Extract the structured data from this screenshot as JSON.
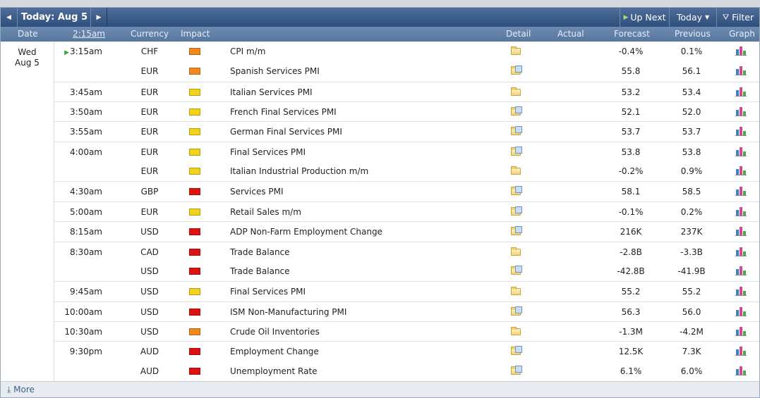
{
  "toolbar": {
    "prev_icon": "◀",
    "today_label": "Today: Aug 5",
    "next_icon": "▶",
    "up_next_label": "Up Next",
    "today_button_label": "Today",
    "filter_label": "Filter"
  },
  "columns": {
    "date": "Date",
    "time": "2:15am",
    "currency": "Currency",
    "impact": "Impact",
    "detail": "Detail",
    "actual": "Actual",
    "forecast": "Forecast",
    "previous": "Previous",
    "graph": "Graph"
  },
  "date_group": {
    "weekday": "Wed",
    "date": "Aug 5"
  },
  "impact_colors": {
    "high": "#dd1212",
    "medium": "#f08a1e",
    "low": "#f2d21a"
  },
  "events": [
    {
      "time": "3:15am",
      "currency": "CHF",
      "impact": "medium",
      "event": "CPI m/m",
      "detail_icon": "folder",
      "actual": "",
      "forecast": "-0.4%",
      "previous": "0.1%",
      "next_up": true
    },
    {
      "time": "",
      "currency": "EUR",
      "impact": "medium",
      "event": "Spanish Services PMI",
      "detail_icon": "folder-doc",
      "actual": "",
      "forecast": "55.8",
      "previous": "56.1"
    },
    {
      "time": "3:45am",
      "currency": "EUR",
      "impact": "low",
      "event": "Italian Services PMI",
      "detail_icon": "folder",
      "actual": "",
      "forecast": "53.2",
      "previous": "53.4"
    },
    {
      "time": "3:50am",
      "currency": "EUR",
      "impact": "low",
      "event": "French Final Services PMI",
      "detail_icon": "folder-doc",
      "actual": "",
      "forecast": "52.1",
      "previous": "52.0"
    },
    {
      "time": "3:55am",
      "currency": "EUR",
      "impact": "low",
      "event": "German Final Services PMI",
      "detail_icon": "folder-doc",
      "actual": "",
      "forecast": "53.7",
      "previous": "53.7"
    },
    {
      "time": "4:00am",
      "currency": "EUR",
      "impact": "low",
      "event": "Final Services PMI",
      "detail_icon": "folder-doc",
      "actual": "",
      "forecast": "53.8",
      "previous": "53.8"
    },
    {
      "time": "",
      "currency": "EUR",
      "impact": "low",
      "event": "Italian Industrial Production m/m",
      "detail_icon": "folder",
      "actual": "",
      "forecast": "-0.2%",
      "previous": "0.9%"
    },
    {
      "time": "4:30am",
      "currency": "GBP",
      "impact": "high",
      "event": "Services PMI",
      "detail_icon": "folder-doc",
      "actual": "",
      "forecast": "58.1",
      "previous": "58.5"
    },
    {
      "time": "5:00am",
      "currency": "EUR",
      "impact": "low",
      "event": "Retail Sales m/m",
      "detail_icon": "folder-doc",
      "actual": "",
      "forecast": "-0.1%",
      "previous": "0.2%"
    },
    {
      "time": "8:15am",
      "currency": "USD",
      "impact": "high",
      "event": "ADP Non-Farm Employment Change",
      "detail_icon": "folder-doc",
      "actual": "",
      "forecast": "216K",
      "previous": "237K"
    },
    {
      "time": "8:30am",
      "currency": "CAD",
      "impact": "high",
      "event": "Trade Balance",
      "detail_icon": "folder",
      "actual": "",
      "forecast": "-2.8B",
      "previous": "-3.3B"
    },
    {
      "time": "",
      "currency": "USD",
      "impact": "high",
      "event": "Trade Balance",
      "detail_icon": "folder-doc",
      "actual": "",
      "forecast": "-42.8B",
      "previous": "-41.9B"
    },
    {
      "time": "9:45am",
      "currency": "USD",
      "impact": "low",
      "event": "Final Services PMI",
      "detail_icon": "folder",
      "actual": "",
      "forecast": "55.2",
      "previous": "55.2"
    },
    {
      "time": "10:00am",
      "currency": "USD",
      "impact": "high",
      "event": "ISM Non-Manufacturing PMI",
      "detail_icon": "folder-doc",
      "actual": "",
      "forecast": "56.3",
      "previous": "56.0"
    },
    {
      "time": "10:30am",
      "currency": "USD",
      "impact": "medium",
      "event": "Crude Oil Inventories",
      "detail_icon": "folder",
      "actual": "",
      "forecast": "-1.3M",
      "previous": "-4.2M"
    },
    {
      "time": "9:30pm",
      "currency": "AUD",
      "impact": "high",
      "event": "Employment Change",
      "detail_icon": "folder-doc",
      "actual": "",
      "forecast": "12.5K",
      "previous": "7.3K"
    },
    {
      "time": "",
      "currency": "AUD",
      "impact": "high",
      "event": "Unemployment Rate",
      "detail_icon": "folder-doc",
      "actual": "",
      "forecast": "6.1%",
      "previous": "6.0%"
    }
  ],
  "footer": {
    "more_icon": "⤓",
    "more_label": "More"
  }
}
